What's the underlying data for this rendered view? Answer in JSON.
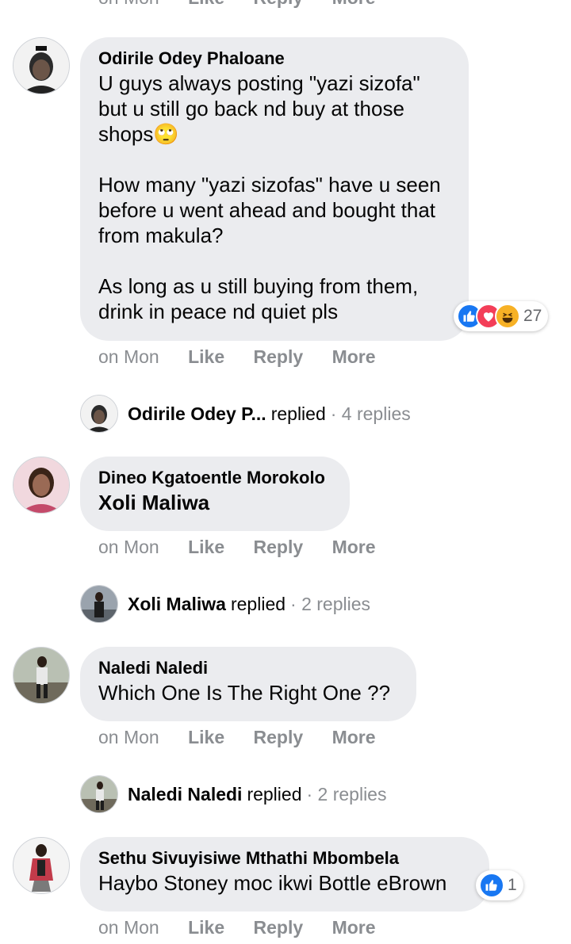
{
  "top_partial": {
    "time": "on Mon",
    "actions": [
      "Like",
      "Reply",
      "More"
    ]
  },
  "comments": [
    {
      "author": "Odirile Odey Phaloane",
      "text": "U guys always posting \"yazi sizofa\" but u still go back nd buy at those shops🙄\n\nHow many \"yazi sizofas\" have u seen before u went ahead and bought that from makula?\n\nAs long as u still buying from them, drink in peace nd quiet pls",
      "time": "on Mon",
      "actions": {
        "like": "Like",
        "reply": "Reply",
        "more": "More"
      },
      "reactions": {
        "types": [
          "like-icon",
          "love-icon",
          "haha-icon"
        ],
        "count": "27"
      },
      "replies_summary": {
        "name": "Odirile Odey P...",
        "verb": "replied",
        "count": "· 4 replies"
      }
    },
    {
      "author": "Dineo Kgatoentle Morokolo",
      "text": "Xoli Maliwa",
      "time": "on Mon",
      "actions": {
        "like": "Like",
        "reply": "Reply",
        "more": "More"
      },
      "replies_summary": {
        "name": "Xoli Maliwa",
        "verb": "replied",
        "count": "· 2 replies"
      }
    },
    {
      "author": "Naledi Naledi",
      "text": "Which One Is The Right One ??",
      "time": "on Mon",
      "actions": {
        "like": "Like",
        "reply": "Reply",
        "more": "More"
      },
      "replies_summary": {
        "name": "Naledi Naledi",
        "verb": "replied",
        "count": "· 2 replies"
      }
    },
    {
      "author": "Sethu Sivuyisiwe Mthathi Mbombela",
      "text": "Haybo Stoney moc ikwi Bottle eBrown",
      "time": "on Mon",
      "actions": {
        "like": "Like",
        "reply": "Reply",
        "more": "More"
      },
      "reactions": {
        "types": [
          "like-icon"
        ],
        "count": "1"
      }
    }
  ],
  "colors": {
    "bubble": "#ebecef",
    "muted": "#8a8d91",
    "text": "#050505",
    "like_blue": "#1877f2",
    "love_red": "#f33e58",
    "haha_yellow": "#f7b125"
  }
}
